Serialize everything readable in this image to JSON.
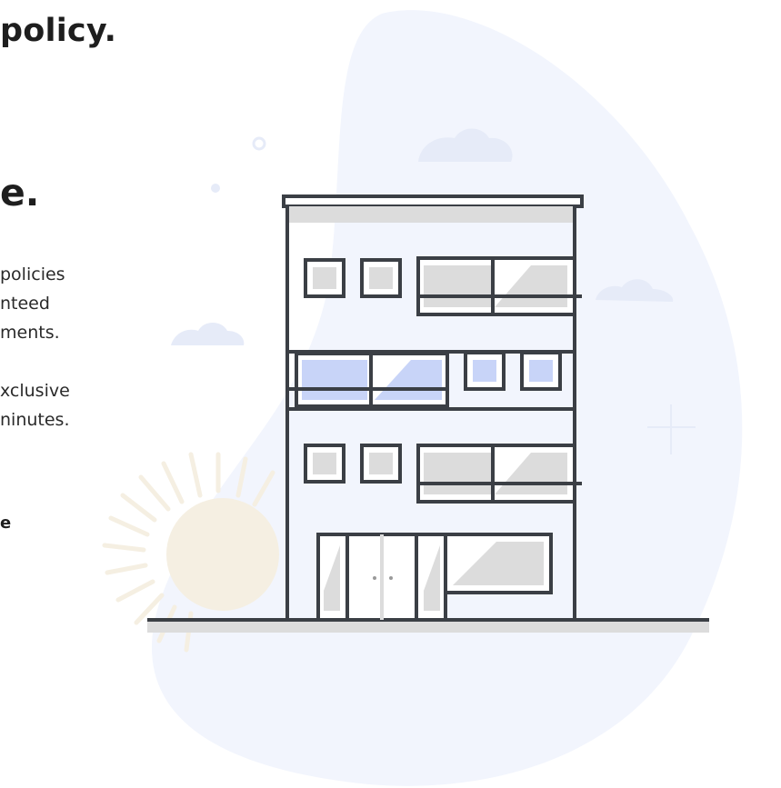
{
  "headline": {
    "line1": "policy.",
    "line2": "e."
  },
  "body": {
    "paragraph1": [
      "policies",
      "nteed",
      "ments."
    ],
    "paragraph2": [
      "xclusive",
      "ninutes."
    ],
    "link_fragment": "e"
  },
  "colors": {
    "blob": "#f2f5fd",
    "outline": "#3b3f45",
    "window_gray": "#dadada",
    "window_blue": "#c8d4f8",
    "sun": "#f5efe2"
  },
  "illustration": {
    "subject": "building-icon"
  }
}
